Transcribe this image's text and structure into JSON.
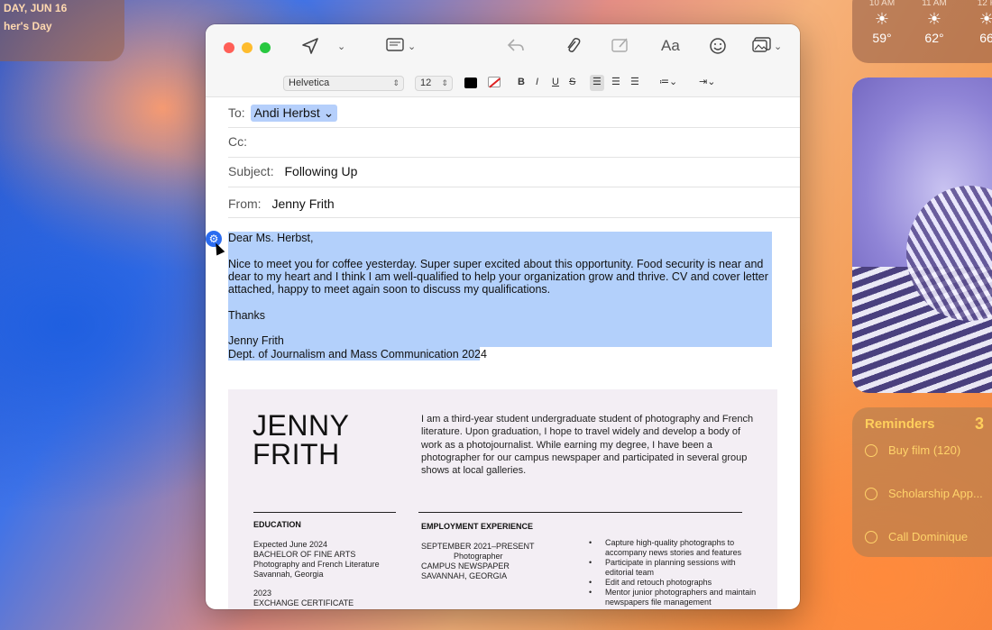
{
  "widgets": {
    "calendar": {
      "date": "DAY, JUN 16",
      "event": "her's Day"
    },
    "weather": [
      {
        "time": "10 AM",
        "icon": "sun-cloud-icon",
        "temp": "59°"
      },
      {
        "time": "11 AM",
        "icon": "sun-cloud-icon",
        "temp": "62°"
      },
      {
        "time": "12 P",
        "icon": "sun-cloud-icon",
        "temp": "66"
      }
    ],
    "reminders": {
      "title": "Reminders",
      "count": "3",
      "items": [
        "Buy film (120)",
        "Scholarship App...",
        "Call Dominique"
      ]
    }
  },
  "compose": {
    "toolbar": {
      "font": "Helvetica",
      "size": "12",
      "bold": "B",
      "italic": "I",
      "underline": "U",
      "strike": "S",
      "font_label": "Aa"
    },
    "headers": {
      "to_label": "To:",
      "to_value": "Andi Herbst",
      "cc_label": "Cc:",
      "subject_label": "Subject:",
      "subject_value": "Following Up",
      "from_label": "From:",
      "from_value": "Jenny Frith"
    },
    "body": {
      "greeting": "Dear Ms. Herbst,",
      "paragraph": "Nice to meet you for coffee yesterday. Super super excited about this opportunity. Food security is near and dear to my heart and I think I am well-qualified to help your organization grow and thrive. CV and cover letter attached, happy to meet again soon to discuss my qualifications.",
      "closing": "Thanks",
      "signature_name": "Jenny Frith",
      "signature_dept": "Dept. of Journalism and Mass Communication 2024"
    },
    "resume": {
      "name_line1": "JENNY",
      "name_line2": "FRITH",
      "intro": "I am a third-year student undergraduate student of photography and French literature. Upon graduation, I hope to travel widely and develop a body of work as a photojournalist. While earning my degree, I have been a photographer for our campus newspaper and participated in several group shows at local galleries.",
      "education_heading": "EDUCATION",
      "edu1_date": "Expected June 2024",
      "edu1_degree": "BACHELOR OF FINE ARTS",
      "edu1_field": "Photography and French Literature",
      "edu1_place": "Savannah, Georgia",
      "edu2_date": "2023",
      "edu2_degree": "EXCHANGE CERTIFICATE",
      "employment_heading": "EMPLOYMENT EXPERIENCE",
      "job1_dates": "SEPTEMBER 2021–PRESENT",
      "job1_title": "Photographer",
      "job1_org": "CAMPUS NEWSPAPER",
      "job1_place": "SAVANNAH, GEORGIA",
      "bullets": [
        "Capture high-quality photographs to accompany news stories and features",
        "Participate in planning sessions with editorial team",
        "Edit and retouch photographs",
        "Mentor junior photographers and maintain newspapers file management"
      ]
    }
  }
}
